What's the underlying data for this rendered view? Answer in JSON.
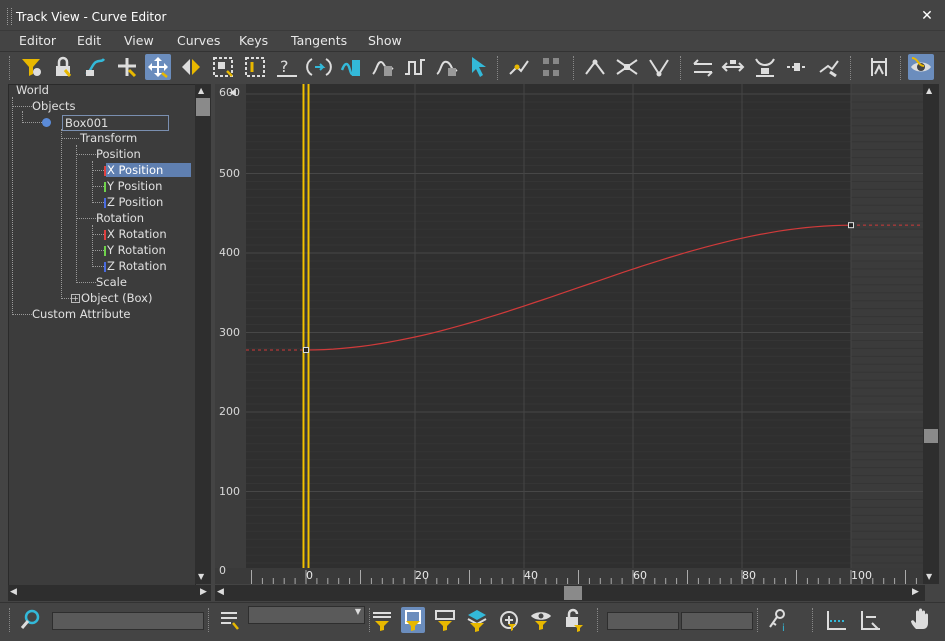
{
  "window": {
    "title": "Track View - Curve Editor"
  },
  "menu": {
    "items": [
      "Editor",
      "Edit",
      "View",
      "Curves",
      "Keys",
      "Tangents",
      "Show"
    ]
  },
  "tree": {
    "world": "World",
    "objects": "Objects",
    "box": "Box001",
    "transform": "Transform",
    "position": "Position",
    "x_position": "X Position",
    "y_position": "Y Position",
    "z_position": "Z Position",
    "rotation": "Rotation",
    "x_rotation": "X Rotation",
    "y_rotation": "Y Rotation",
    "z_rotation": "Z Rotation",
    "scale": "Scale",
    "object_box": "Object (Box)",
    "custom_attribute": "Custom Attribute"
  },
  "graph": {
    "y_ticks": [
      "600",
      "500",
      "400",
      "300",
      "200",
      "100",
      "0"
    ],
    "x_ticks": [
      "0",
      "20",
      "40",
      "60",
      "80",
      "100"
    ],
    "y_top_label": "600"
  },
  "chart_data": {
    "type": "line",
    "series": [
      {
        "color": "#d03a3a",
        "x": [
          0,
          100
        ],
        "values": [
          278,
          435
        ]
      }
    ],
    "keys": [
      {
        "frame": 0,
        "value": 278
      },
      {
        "frame": 100,
        "value": 435
      }
    ],
    "xlim": [
      -10,
      113
    ],
    "ylim": [
      0,
      630
    ],
    "current_frame": 0
  },
  "colors": {
    "accent": "#6b8dbd",
    "curve": "#d03a3a",
    "time_slider": "#f2c200",
    "x_axis": "#e04040",
    "y_axis": "#6fd24b",
    "z_axis": "#4a6be0"
  }
}
